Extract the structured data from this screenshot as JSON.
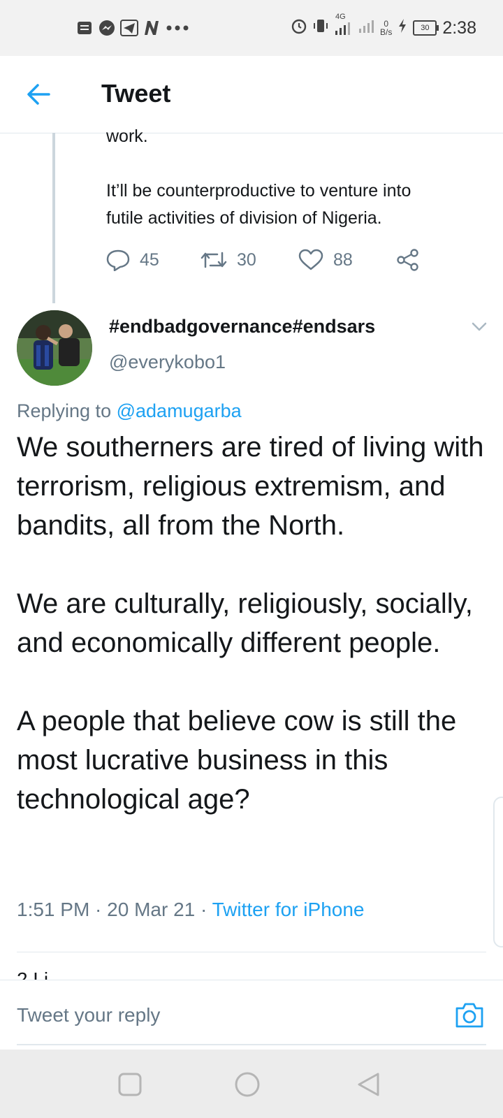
{
  "status_bar": {
    "time": "2:38",
    "network_type": "4G",
    "data_rate_value": "0",
    "data_rate_unit": "B/s",
    "battery": "30",
    "notification_icons": [
      "message-icon",
      "messenger-icon",
      "telegram-icon",
      "n-app-icon",
      "more-dots-icon"
    ]
  },
  "header": {
    "title": "Tweet"
  },
  "previous_tweet": {
    "text_line_1": "work.",
    "text_line_2": "It’ll be counterproductive to venture into",
    "text_line_3": "futile activities of division of Nigeria.",
    "replies": "45",
    "retweets": "30",
    "likes": "88"
  },
  "tweet": {
    "display_name": "#endbadgovernance#endsars",
    "handle": "@everykobo1",
    "replying_prefix": "Replying to",
    "replying_to": "@adamugarba",
    "paragraph_1": "We southerners are tired of living with terrorism, religious extremism, and bandits, all from the North.",
    "paragraph_2": "We are culturally, religiously, socially, and economically different people.",
    "paragraph_3": "A people that believe cow is still the most lucrative business in this technological age?",
    "timestamp": "1:51 PM · 20 Mar 21 · ",
    "source": "Twitter for iPhone",
    "likes_peek": "2 Li"
  },
  "reply_bar": {
    "placeholder": "Tweet your reply"
  },
  "colors": {
    "accent": "#1da1f2",
    "secondary_text": "#657786",
    "divider": "#e1e8ed"
  }
}
